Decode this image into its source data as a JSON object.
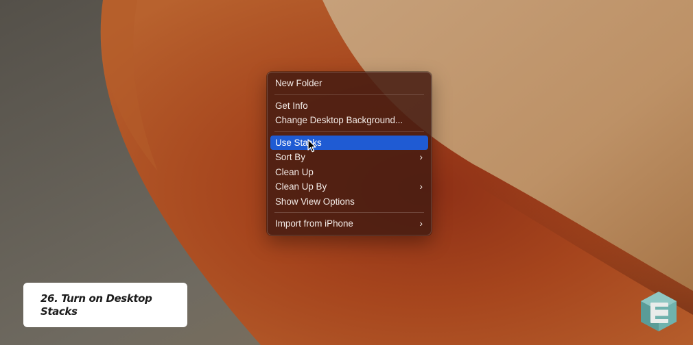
{
  "context_menu": {
    "items": [
      {
        "label": "New Folder",
        "has_submenu": false
      },
      {
        "label": "Get Info",
        "has_submenu": false
      },
      {
        "label": "Change Desktop Background...",
        "has_submenu": false
      },
      {
        "label": "Use Stacks",
        "has_submenu": false,
        "highlighted": true
      },
      {
        "label": "Sort By",
        "has_submenu": true
      },
      {
        "label": "Clean Up",
        "has_submenu": false
      },
      {
        "label": "Clean Up By",
        "has_submenu": true
      },
      {
        "label": "Show View Options",
        "has_submenu": false
      },
      {
        "label": "Import from iPhone",
        "has_submenu": true
      }
    ],
    "chevron_glyph": "›",
    "highlight_color": "#1f5bd3"
  },
  "caption": {
    "text": "26. Turn on Desktop Stacks"
  },
  "colors": {
    "wallpaper_orange": "#a5441c",
    "wallpaper_tan": "#c29a72",
    "wallpaper_gray": "#6a655d",
    "logo_teal": "#6fb2ad",
    "logo_white": "#e9ecea"
  },
  "icons": {
    "cursor": "arrow-cursor-icon",
    "logo": "brand-logo-icon"
  }
}
